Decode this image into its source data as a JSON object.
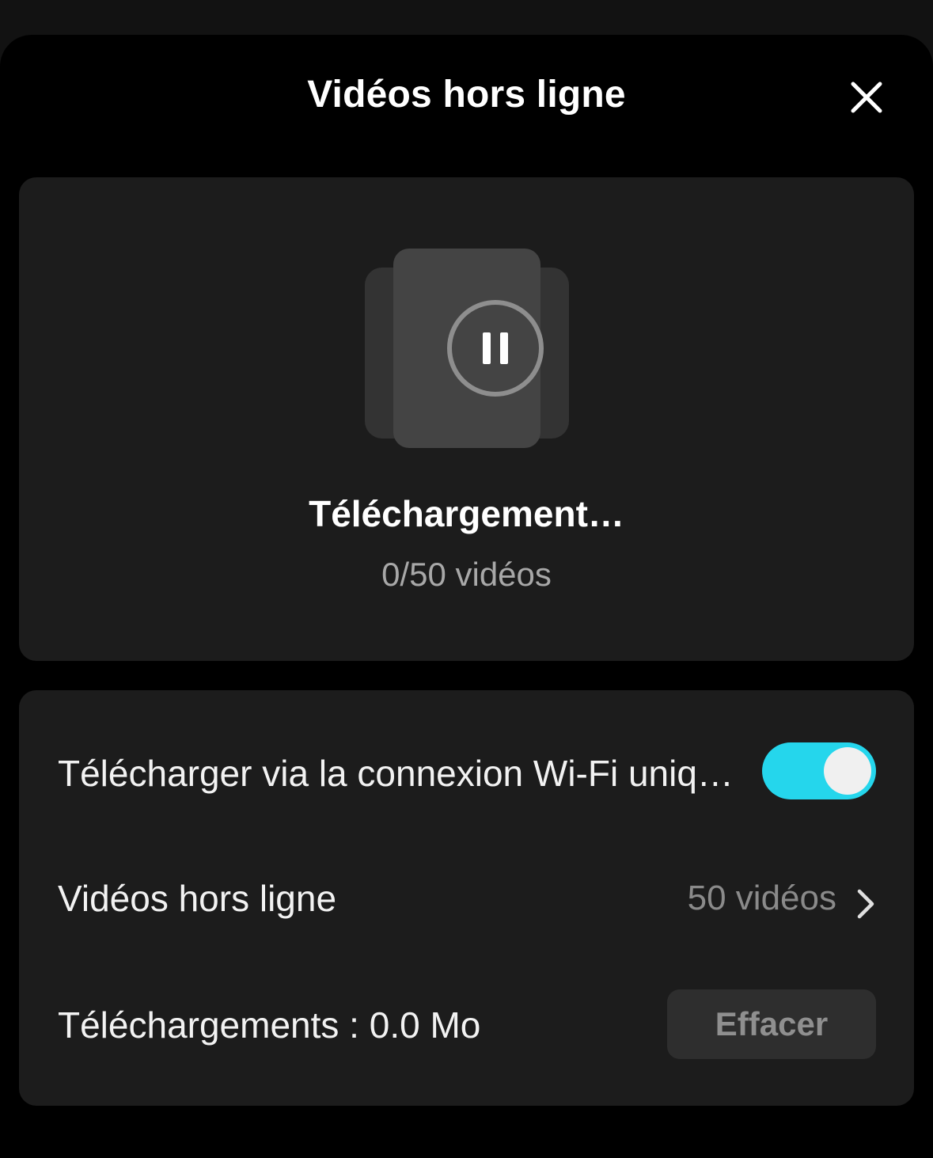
{
  "header": {
    "title": "Vidéos hors ligne",
    "close_icon": "close-icon"
  },
  "download": {
    "status": "Téléchargement…",
    "count": "0/50 vidéos",
    "pause_icon": "pause-icon",
    "stack_icon": "video-stack-icon"
  },
  "settings": {
    "wifi": {
      "label": "Télécharger via la connexion Wi-Fi uniquement",
      "enabled": true
    },
    "offline_videos": {
      "label": "Vidéos hors ligne",
      "value": "50 vidéos",
      "chevron_icon": "chevron-right-icon"
    },
    "storage": {
      "label": "Téléchargements : 0.0 Mo",
      "clear_label": "Effacer"
    }
  },
  "colors": {
    "accent": "#25d6ec",
    "background": "#000000",
    "card": "#1c1c1c"
  }
}
